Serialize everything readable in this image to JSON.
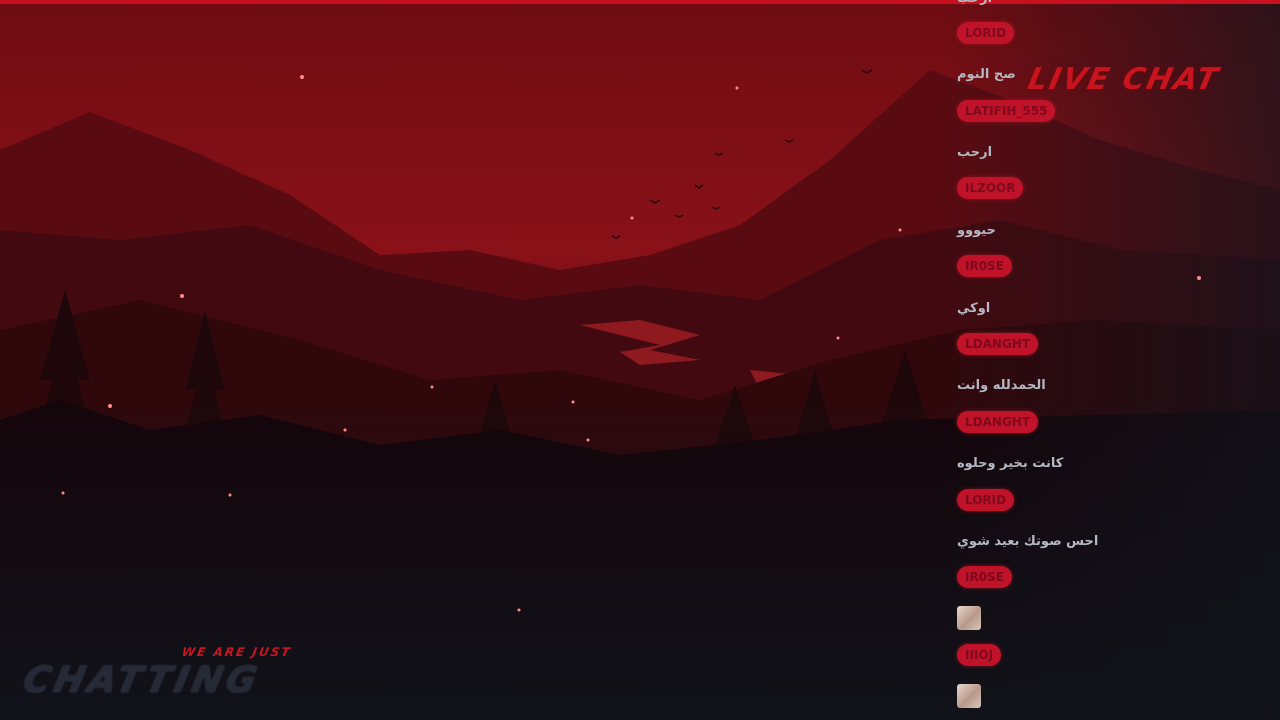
{
  "stream": {
    "chat_title": "LIVE CHAT",
    "overlay_small": "WE ARE JUST",
    "overlay_big": "CHATTING",
    "accent_color": "#c8141e"
  },
  "chat": {
    "messages": [
      {
        "username": "LORID",
        "text": "صح النوم"
      },
      {
        "username": "LATIFIH_555",
        "text": "ارحب"
      },
      {
        "username": "ILZOOR",
        "text": "حيووو"
      },
      {
        "username": "IR0SE",
        "text": "اوكي"
      },
      {
        "username": "LDANGHT",
        "text": "الحمدلله وانت"
      },
      {
        "username": "LDANGHT",
        "text": "كانت بخير وحلوه"
      },
      {
        "username": "LORID",
        "text": "احس صوتك بعيد شوي"
      },
      {
        "username": "IR0SE",
        "avatar": "emote-image"
      },
      {
        "username": "IIIOJ",
        "avatar": "emote-image"
      }
    ]
  }
}
